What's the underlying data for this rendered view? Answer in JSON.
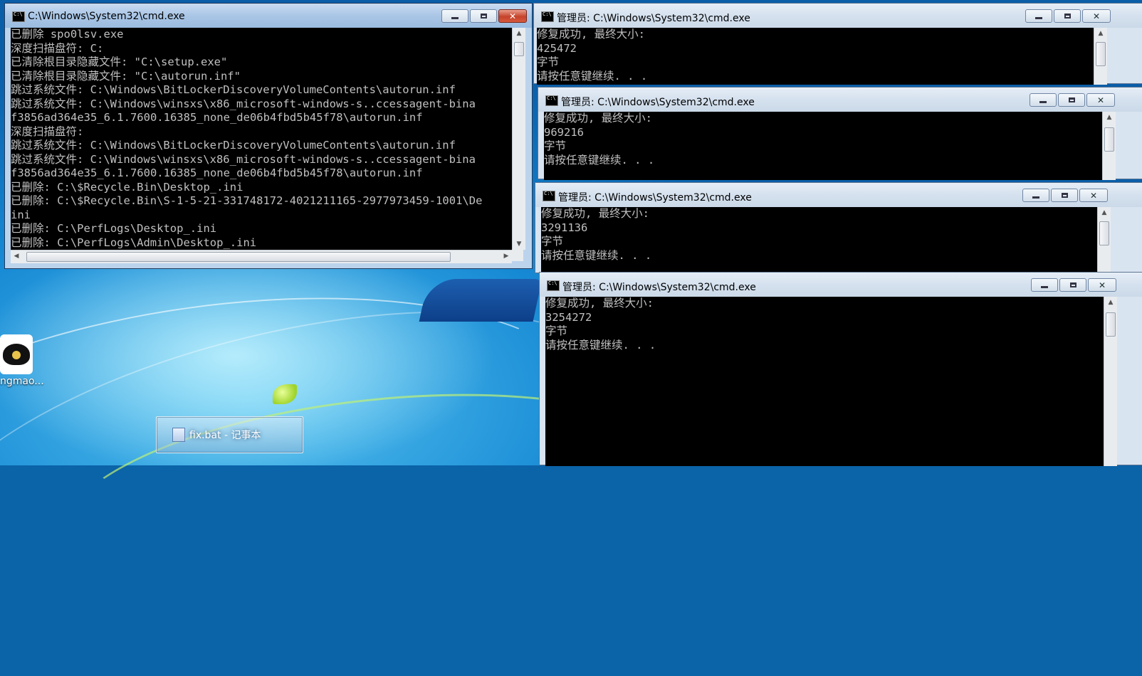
{
  "desktop": {
    "icon_label": "ngmao...",
    "taskbar_item": {
      "label": "fix.bat - 记事本",
      "icon": "notepad-icon"
    }
  },
  "main_window": {
    "title": "C:\\Windows\\System32\\cmd.exe",
    "icon": "cmd-icon",
    "lines": [
      "已删除 spo0lsv.exe",
      "深度扫描盘符: C:",
      "已清除根目录隐藏文件: \"C:\\setup.exe\"",
      "已清除根目录隐藏文件: \"C:\\autorun.inf\"",
      "跳过系统文件: C:\\Windows\\BitLockerDiscoveryVolumeContents\\autorun.inf",
      "跳过系统文件: C:\\Windows\\winsxs\\x86_microsoft-windows-s..ccessagent-bina",
      "f3856ad364e35_6.1.7600.16385_none_de06b4fbd5b45f78\\autorun.inf",
      "深度扫描盘符:",
      "跳过系统文件: C:\\Windows\\BitLockerDiscoveryVolumeContents\\autorun.inf",
      "跳过系统文件: C:\\Windows\\winsxs\\x86_microsoft-windows-s..ccessagent-bina",
      "f3856ad364e35_6.1.7600.16385_none_de06b4fbd5b45f78\\autorun.inf",
      "已删除: C:\\$Recycle.Bin\\Desktop_.ini",
      "已删除: C:\\$Recycle.Bin\\S-1-5-21-331748172-4021211165-2977973459-1001\\De",
      "ini",
      "已删除: C:\\PerfLogs\\Desktop_.ini",
      "已删除: C:\\PerfLogs\\Admin\\Desktop_.ini"
    ]
  },
  "admin_windows": [
    {
      "title": "管理员: C:\\Windows\\System32\\cmd.exe",
      "lines": [
        "修复成功, 最终大小:",
        "425472",
        "字节",
        "请按任意键继续. . ."
      ]
    },
    {
      "title": "管理员: C:\\Windows\\System32\\cmd.exe",
      "lines": [
        "修复成功, 最终大小:",
        "969216",
        "字节",
        "请按任意键继续. . ."
      ]
    },
    {
      "title": "管理员: C:\\Windows\\System32\\cmd.exe",
      "lines": [
        "修复成功, 最终大小:",
        "3291136",
        "字节",
        "请按任意键继续. . ."
      ]
    },
    {
      "title": "管理员: C:\\Windows\\System32\\cmd.exe",
      "lines": [
        "修复成功, 最终大小:",
        "3254272",
        "字节",
        "请按任意键继续. . ."
      ]
    }
  ]
}
